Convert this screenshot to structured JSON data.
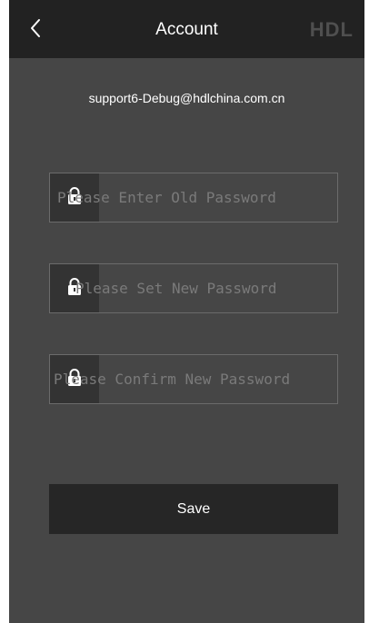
{
  "header": {
    "title": "Account",
    "logo_text": "HDL",
    "back_icon": "chevron-left-icon"
  },
  "account": {
    "email": "support6-Debug@hdlchina.com.cn"
  },
  "form": {
    "old_password": {
      "value": "",
      "placeholder": "Please Enter Old Password",
      "icon": "lock-icon"
    },
    "new_password": {
      "value": "",
      "placeholder": "Please Set New Password",
      "icon": "lock-icon"
    },
    "confirm_password": {
      "value": "",
      "placeholder": "Please Confirm New Password",
      "icon": "lock-icon"
    },
    "save_label": "Save"
  },
  "colors": {
    "background": "#464646",
    "header": "#222222",
    "field_border": "#6b6b6b",
    "icon_box": "#333333",
    "button": "#262626",
    "placeholder": "#7a7a7a",
    "text": "#ffffff"
  }
}
